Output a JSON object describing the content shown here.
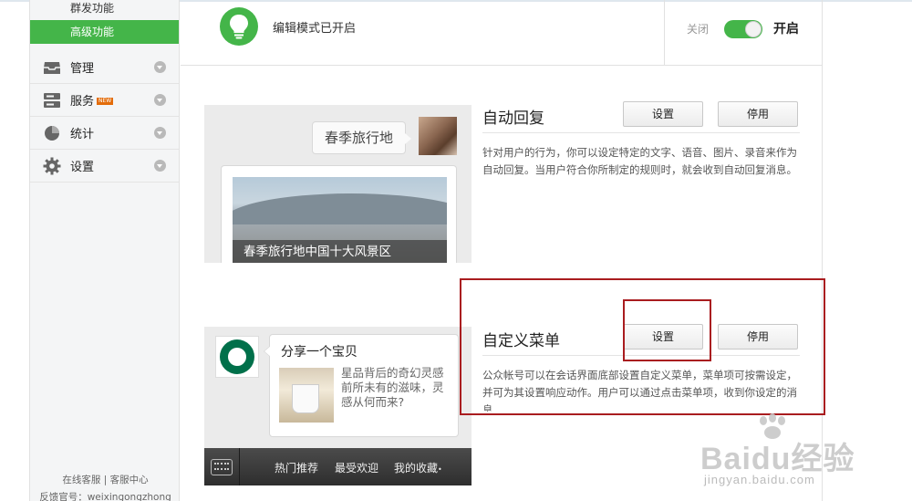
{
  "sidebar": {
    "sub_items": [
      "群发功能",
      "高级功能"
    ],
    "items": [
      {
        "label": "管理",
        "icon": "inbox-icon"
      },
      {
        "label": "服务",
        "icon": "server-icon",
        "badge": "NEW"
      },
      {
        "label": "统计",
        "icon": "pie-chart-icon"
      },
      {
        "label": "设置",
        "icon": "gear-icon"
      }
    ],
    "footer_links": {
      "online_service": "在线客服",
      "separator": "|",
      "help_center": "客服中心"
    },
    "footer_account": "反馈官号：weixingongzhong"
  },
  "header": {
    "title": "编辑模式已开启",
    "toggle_off_label": "关闭",
    "toggle_on_label": "开启",
    "toggle_state": "on"
  },
  "preview1": {
    "bubble_text": "春季旅行地",
    "news_caption": "春季旅行地中国十大风景区"
  },
  "preview2": {
    "msg_title": "分享一个宝贝",
    "msg_desc": "星品背后的奇幻灵感前所未有的滋味，灵感从何而来?",
    "menu": [
      "热门推荐",
      "最受欢迎",
      "我的收藏"
    ],
    "menu_more": "•"
  },
  "features": [
    {
      "title": "自动回复",
      "set_label": "设置",
      "disable_label": "停用",
      "desc": "针对用户的行为，你可以设定特定的文字、语音、图片、录音来作为自动回复。当用户符合你所制定的规则时，就会收到自动回复消息。"
    },
    {
      "title": "自定义菜单",
      "set_label": "设置",
      "disable_label": "停用",
      "desc": "公众帐号可以在会话界面底部设置自定义菜单，菜单项可按需设定，并可为其设置响应动作。用户可以通过点击菜单项，收到你设定的消息"
    }
  ],
  "watermark": {
    "brand": "Baidu经验",
    "url": "jingyan.baidu.com"
  },
  "colors": {
    "accent": "#44b549",
    "highlight_box": "#a91c1f"
  }
}
